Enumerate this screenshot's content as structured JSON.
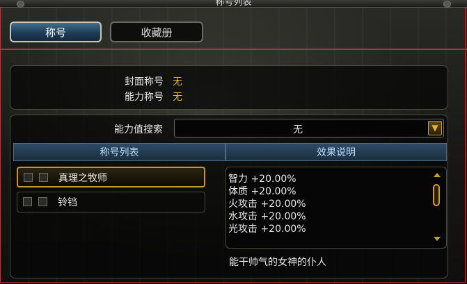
{
  "window": {
    "title": "称号列表"
  },
  "tabs": [
    {
      "label": "称号"
    },
    {
      "label": "收藏册"
    }
  ],
  "summary": {
    "cover_title_label": "封面称号",
    "cover_title_value": "无",
    "ability_title_label": "能力称号",
    "ability_title_value": "无"
  },
  "search": {
    "label": "能力值搜索",
    "selected": "无"
  },
  "columns": {
    "list_header": "称号列表",
    "effect_header": "效果说明"
  },
  "titles": [
    {
      "label": "真理之牧师",
      "selected": true
    },
    {
      "label": "铃铛",
      "selected": false
    }
  ],
  "effects": [
    "智力 +20.00%",
    "体质 +20.00%",
    "火攻击 +20.00%",
    "水攻击 +20.00%",
    "光攻击 +20.00%"
  ],
  "description": "能干帅气的女神的仆人",
  "colors": {
    "accent_gold": "#e5b23c",
    "border_red": "#b5333b",
    "tab_blue": "#2e5777"
  }
}
